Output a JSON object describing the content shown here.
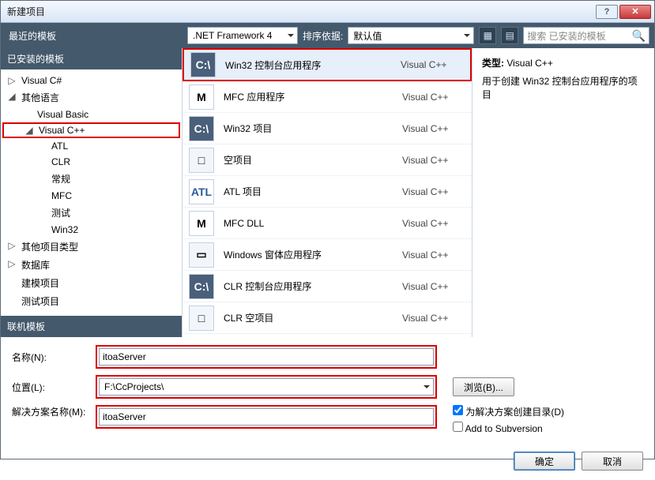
{
  "window": {
    "title": "新建项目"
  },
  "toolbar": {
    "recent_label": "最近的模板",
    "framework_label": ".NET Framework 4",
    "sort_label": "排序依据:",
    "sort_value": "默认值",
    "search_placeholder": "搜索 已安装的模板"
  },
  "tree": {
    "installed_header": "已安装的模板",
    "online_header": "联机模板",
    "items": [
      {
        "label": "Visual C#",
        "level": 1,
        "expander": "▷"
      },
      {
        "label": "其他语言",
        "level": 1,
        "expander": "◢"
      },
      {
        "label": "Visual Basic",
        "level": 2,
        "expander": ""
      },
      {
        "label": "Visual C++",
        "level": 2,
        "expander": "◢",
        "highlight": true
      },
      {
        "label": "ATL",
        "level": 3,
        "expander": ""
      },
      {
        "label": "CLR",
        "level": 3,
        "expander": ""
      },
      {
        "label": "常规",
        "level": 3,
        "expander": ""
      },
      {
        "label": "MFC",
        "level": 3,
        "expander": ""
      },
      {
        "label": "测试",
        "level": 3,
        "expander": ""
      },
      {
        "label": "Win32",
        "level": 3,
        "expander": ""
      },
      {
        "label": "其他项目类型",
        "level": 1,
        "expander": "▷"
      },
      {
        "label": "数据库",
        "level": 1,
        "expander": "▷"
      },
      {
        "label": "建模项目",
        "level": 1,
        "expander": ""
      },
      {
        "label": "测试项目",
        "level": 1,
        "expander": ""
      }
    ]
  },
  "templates": [
    {
      "name": "Win32 控制台应用程序",
      "cat": "Visual C++",
      "icon": "C:\\",
      "selected": true,
      "style": "ic-cpp"
    },
    {
      "name": "MFC 应用程序",
      "cat": "Visual C++",
      "icon": "M",
      "style": "ic-mfc"
    },
    {
      "name": "Win32 项目",
      "cat": "Visual C++",
      "icon": "C:\\",
      "style": "ic-cpp"
    },
    {
      "name": "空项目",
      "cat": "Visual C++",
      "icon": "□",
      "style": ""
    },
    {
      "name": "ATL 项目",
      "cat": "Visual C++",
      "icon": "ATL",
      "style": "ic-atl"
    },
    {
      "name": "MFC DLL",
      "cat": "Visual C++",
      "icon": "M",
      "style": "ic-mfc"
    },
    {
      "name": "Windows 窗体应用程序",
      "cat": "Visual C++",
      "icon": "▭",
      "style": ""
    },
    {
      "name": "CLR 控制台应用程序",
      "cat": "Visual C++",
      "icon": "C:\\",
      "style": "ic-cpp"
    },
    {
      "name": "CLR 空项目",
      "cat": "Visual C++",
      "icon": "□",
      "style": ""
    }
  ],
  "details": {
    "type_label": "类型:",
    "type_value": "Visual C++",
    "desc": "用于创建 Win32 控制台应用程序的项目"
  },
  "form": {
    "name_label": "名称(N):",
    "name_value": "itoaServer",
    "loc_label": "位置(L):",
    "loc_value": "F:\\CcProjects\\",
    "sol_label": "解决方案名称(M):",
    "sol_value": "itoaServer",
    "browse_label": "浏览(B)...",
    "opt_createdir": "为解决方案创建目录(D)",
    "opt_svn": "Add to Subversion"
  },
  "buttons": {
    "ok": "确定",
    "cancel": "取消"
  }
}
